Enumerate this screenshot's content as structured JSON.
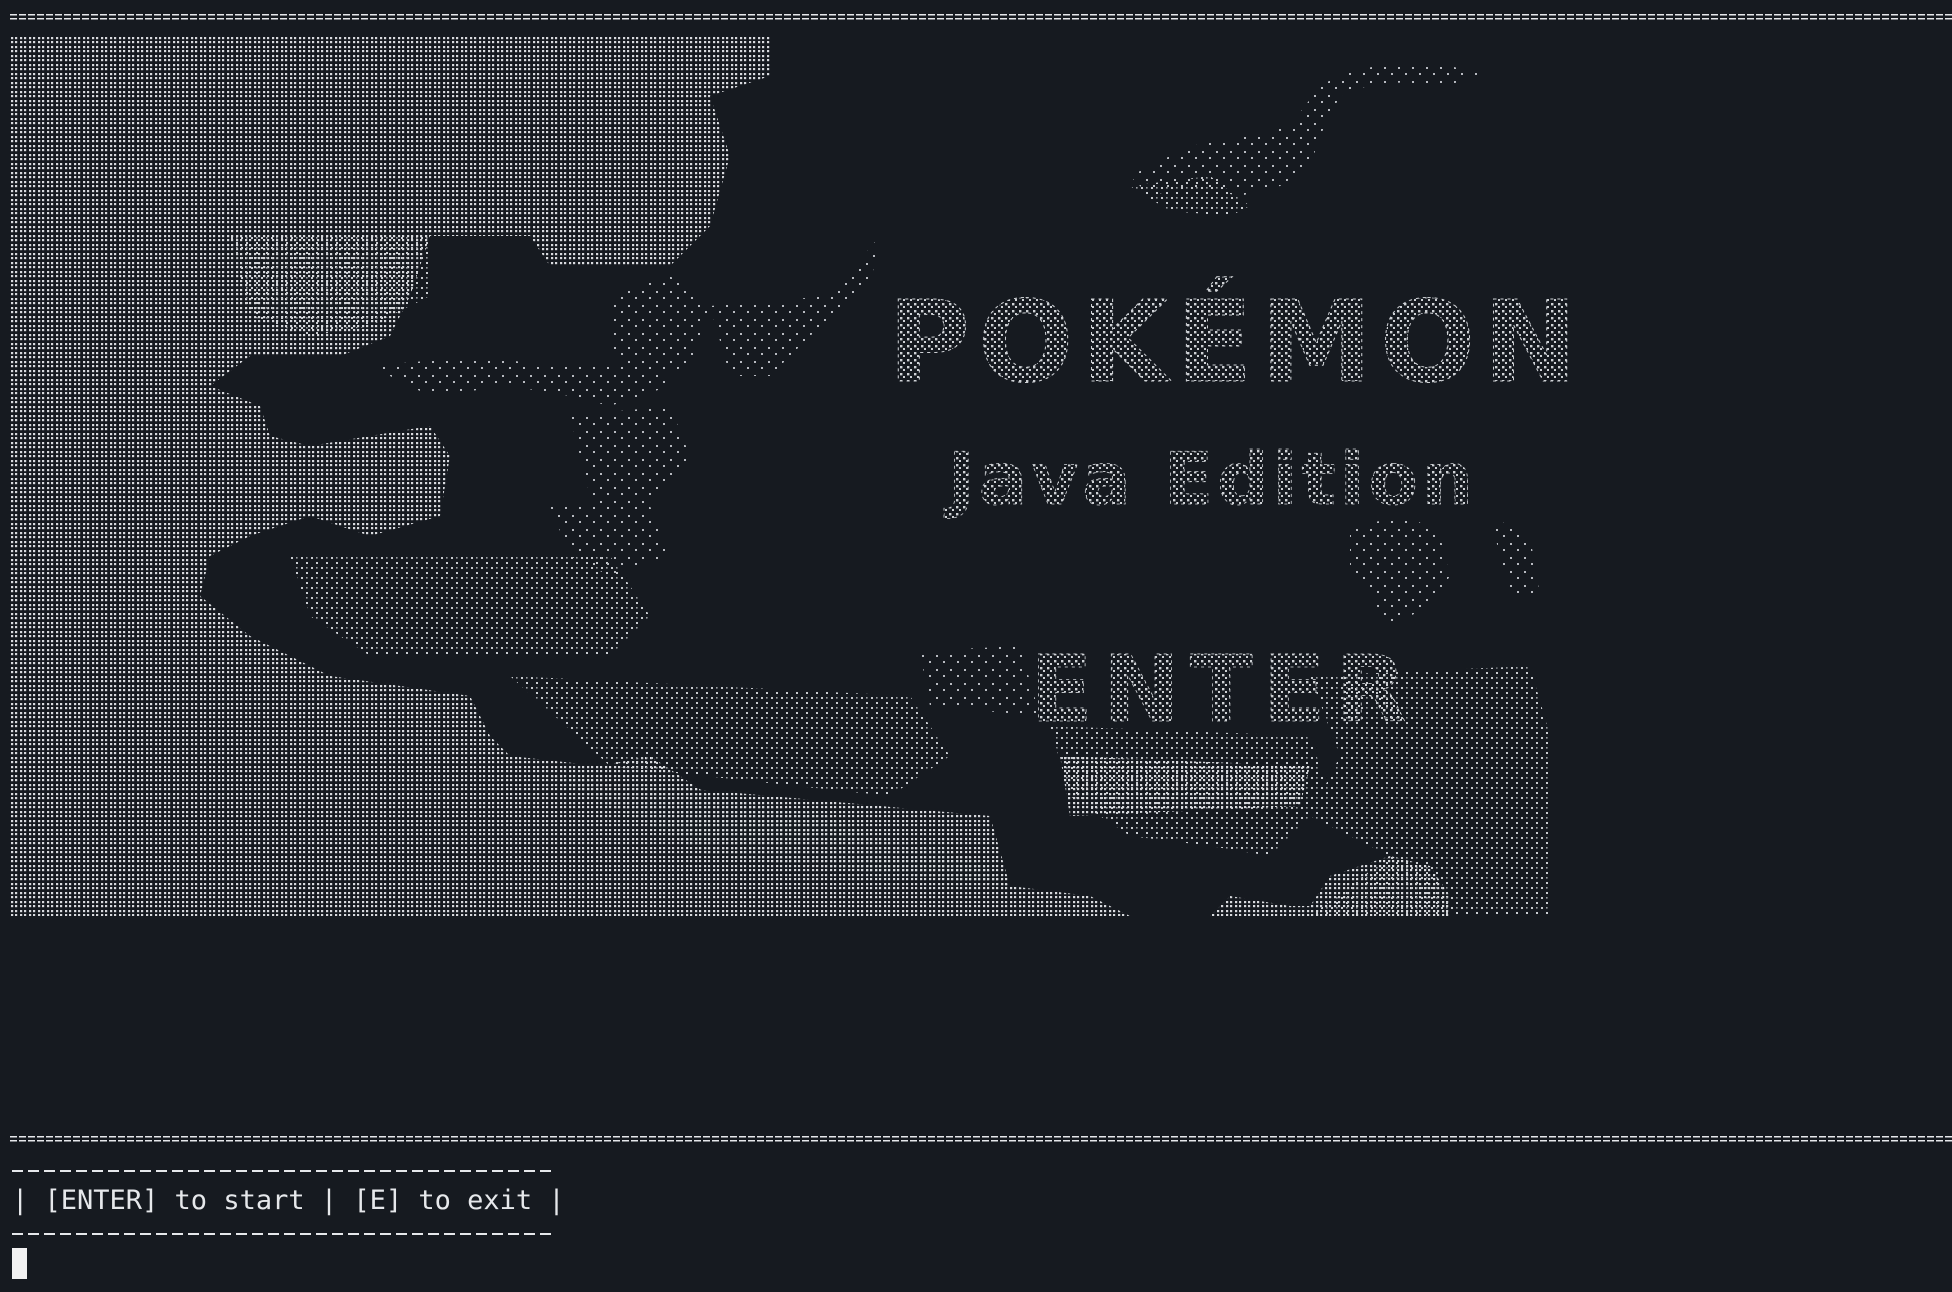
{
  "window": {
    "title": ""
  },
  "splash": {
    "logo_text": "POKÉMON",
    "subtitle": "Java Edition",
    "enter_key_label": "ENTER"
  },
  "menu": {
    "line": "| [ENTER] to start | [E] to exit |",
    "start_key": "[ENTER]",
    "start_text": "to start",
    "exit_key": "[E]",
    "exit_text": "to exit"
  },
  "colors": {
    "background": "#161a20",
    "foreground": "#e6e8eb"
  },
  "icons": {
    "cursor": "block-cursor"
  }
}
